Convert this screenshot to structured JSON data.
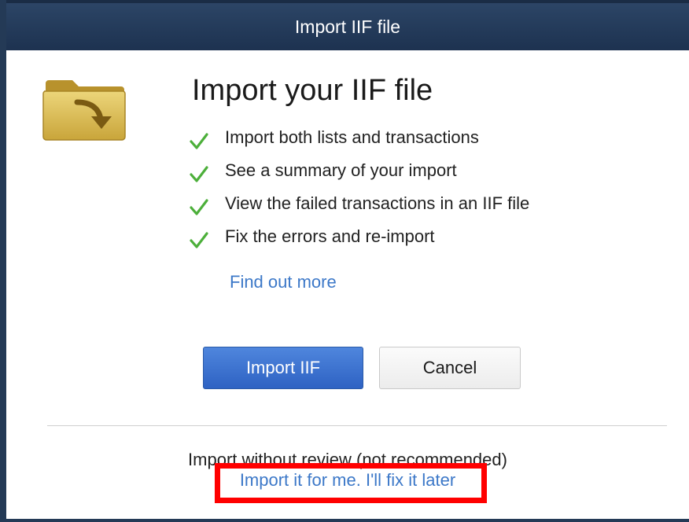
{
  "window": {
    "title": "Import IIF file"
  },
  "main": {
    "heading": "Import your IIF file",
    "features": [
      "Import both lists and transactions",
      "See a summary of your import",
      "View the failed transactions in an IIF file",
      "Fix the errors and re-import"
    ],
    "find_more_label": "Find out more"
  },
  "buttons": {
    "import_label": "Import IIF",
    "cancel_label": "Cancel"
  },
  "footer": {
    "no_review_text": "Import without review (not recommended)",
    "import_later_label": "Import it for me. I'll fix it later"
  },
  "icons": {
    "folder": "folder-import-icon",
    "check": "checkmark-icon"
  },
  "colors": {
    "titlebar": "#243a56",
    "link": "#3c78c8",
    "primary_button": "#3a70d0",
    "check": "#4caf3a",
    "highlight": "#ff0000",
    "folder": "#d9b84a"
  }
}
